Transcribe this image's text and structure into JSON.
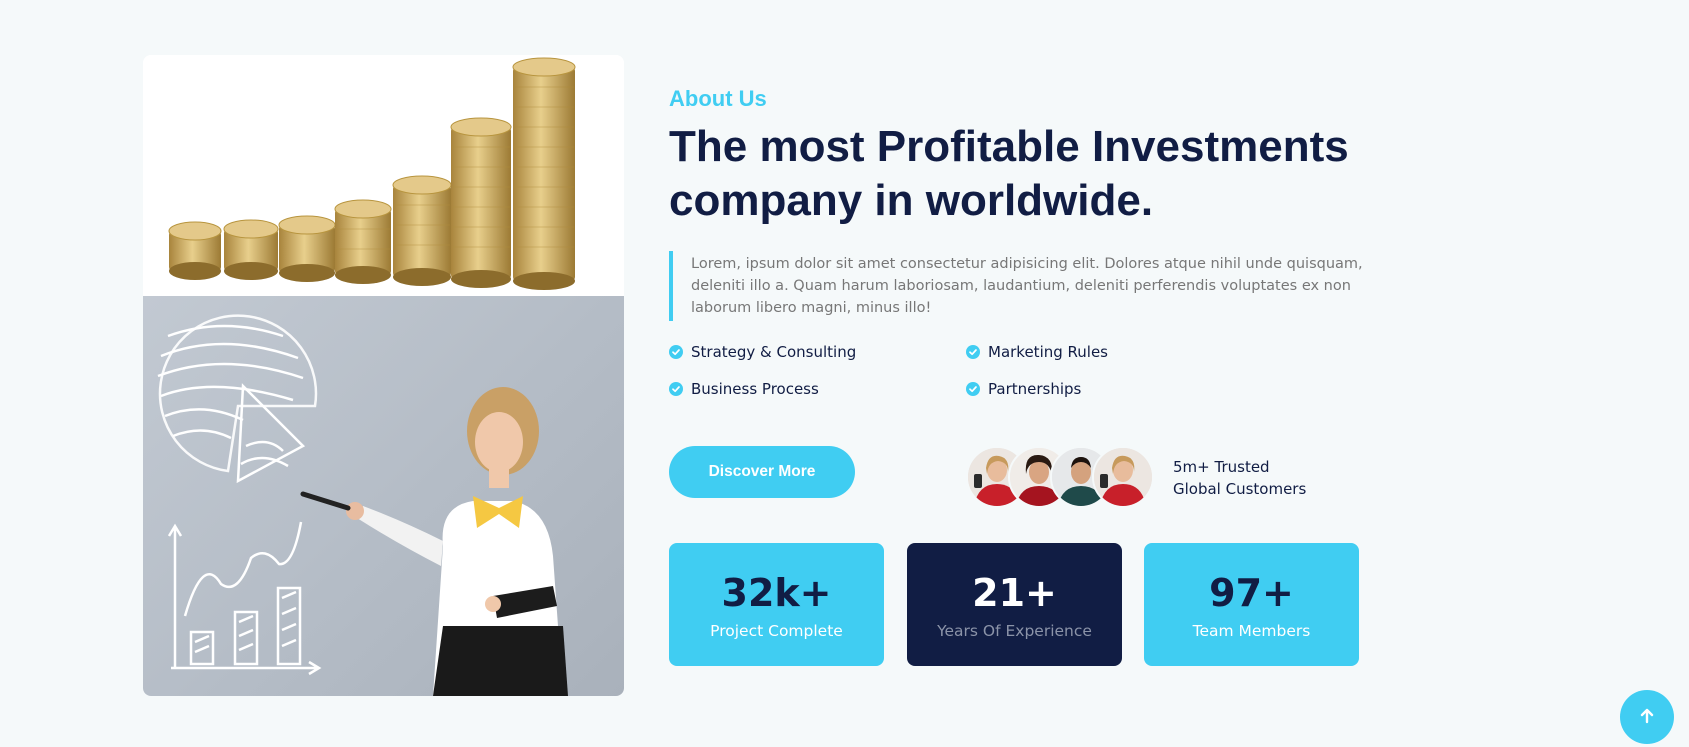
{
  "about": {
    "eyebrow": "About Us",
    "headline_line1": "The most Profitable Investments",
    "headline_line2": "company in worldwide.",
    "description": "Lorem, ipsum dolor sit amet consectetur adipisicing elit. Dolores atque nihil unde quisquam, deleniti illo a. Quam harum laboriosam, laudantium, deleniti perferendis voluptates ex non laborum libero magni, minus illo!"
  },
  "features": [
    {
      "label": "Strategy & Consulting",
      "icon": "check-circle-icon"
    },
    {
      "label": "Marketing Rules",
      "icon": "check-circle-icon"
    },
    {
      "label": "Business Process",
      "icon": "check-circle-icon"
    },
    {
      "label": "Partnerships",
      "icon": "check-circle-icon"
    }
  ],
  "cta": {
    "label": "Discover More"
  },
  "trusted": {
    "line1": "5m+ Trusted",
    "line2": "Global Customers"
  },
  "stats": [
    {
      "value": "32k+",
      "label": "Project Complete",
      "style": "light"
    },
    {
      "value": "21+",
      "label": "Years Of Experience",
      "style": "dark"
    },
    {
      "value": "97+",
      "label": "Team Members",
      "style": "light"
    }
  ],
  "scroll_top": {
    "icon": "arrow-up-icon"
  },
  "colors": {
    "accent": "#40cdf2",
    "navy": "#111d44",
    "background": "#f5f9fa",
    "muted": "#777777"
  }
}
